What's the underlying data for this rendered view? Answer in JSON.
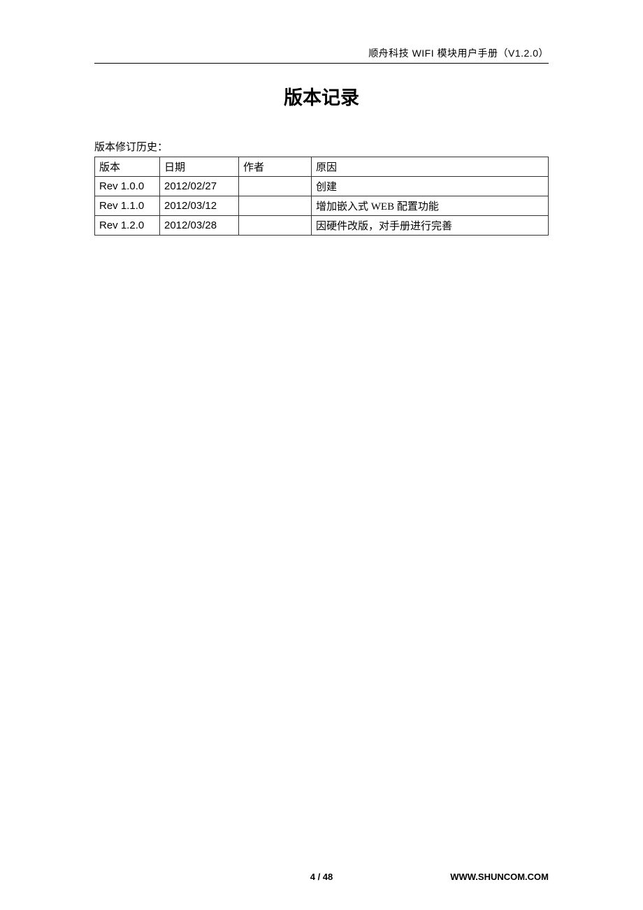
{
  "header": {
    "text": "顺舟科技 WIFI 模块用户手册（V1.2.0）"
  },
  "title": "版本记录",
  "subtitle": "版本修订历史：",
  "table": {
    "headers": [
      "版本",
      "日期",
      "作者",
      "原因"
    ],
    "rows": [
      {
        "version": "Rev 1.0.0",
        "date": "2012/02/27",
        "author": "",
        "reason": "创建"
      },
      {
        "version": "Rev 1.1.0",
        "date": "2012/03/12",
        "author": "",
        "reason": "增加嵌入式 WEB 配置功能"
      },
      {
        "version": "Rev 1.2.0",
        "date": "2012/03/28",
        "author": "",
        "reason": "因硬件改版，对手册进行完善"
      }
    ]
  },
  "footer": {
    "page": "4 / 48",
    "url": "WWW.SHUNCOM.COM"
  }
}
